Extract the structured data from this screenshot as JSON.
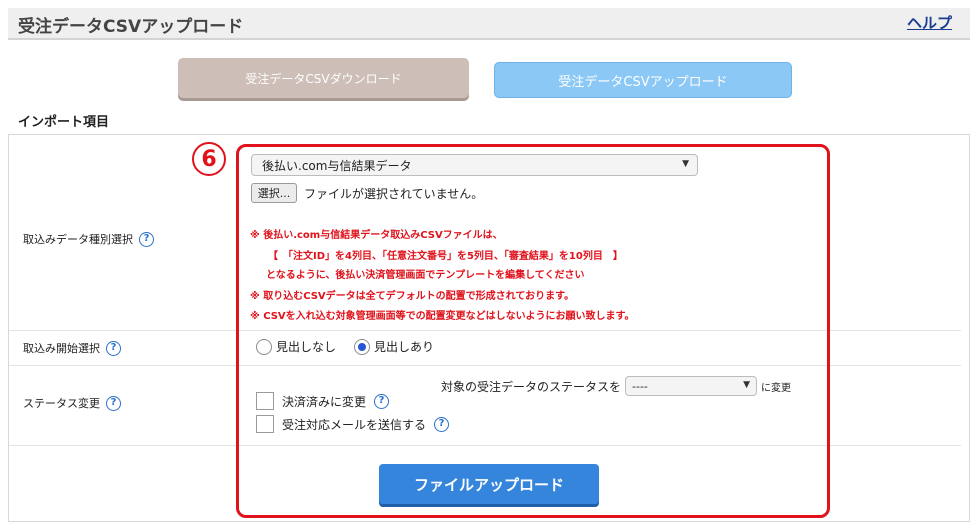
{
  "header": {
    "title": "受注データCSVアップロード",
    "help": "ヘルプ"
  },
  "tabs": {
    "download": "受注データCSVダウンロード",
    "upload": "受注データCSVアップロード"
  },
  "section_title": "インポート項目",
  "step_badge": "6",
  "rows": {
    "type_label": "取込みデータ種別選択",
    "start_label": "取込み開始選択",
    "status_label": "ステータス変更"
  },
  "data_type_select": {
    "value": "後払い.com与信結果データ"
  },
  "file_input": {
    "button": "選択...",
    "status": "ファイルが選択されていません。"
  },
  "notes": [
    "※ 後払い.com与信結果データ取込みCSVファイルは、",
    "【　「注文ID」を4列目、「任意注文番号」を5列目、「審査結果」を10列目　】",
    "となるように、後払い決済管理画面でテンプレートを編集してください",
    "※ 取り込むCSVデータは全てデフォルトの配置で形成されております。",
    "※ CSVを入れ込む対象管理画面等での配置変更などはしないようにお願い致します。"
  ],
  "header_options": [
    {
      "label": "見出しなし",
      "selected": false
    },
    {
      "label": "見出しあり",
      "selected": true
    }
  ],
  "status_change": {
    "prefix": "対象の受注データのステータスを",
    "select_value": "----",
    "suffix": "に変更",
    "check_settled": "決済済みに変更",
    "check_mail": "受注対応メールを送信する"
  },
  "upload_button": "ファイルアップロード",
  "colors": {
    "accent_red": "#e0121b",
    "button_blue": "#3585dc",
    "tab_upload": "#8cc8f5",
    "tab_download": "#cdbfb8"
  }
}
